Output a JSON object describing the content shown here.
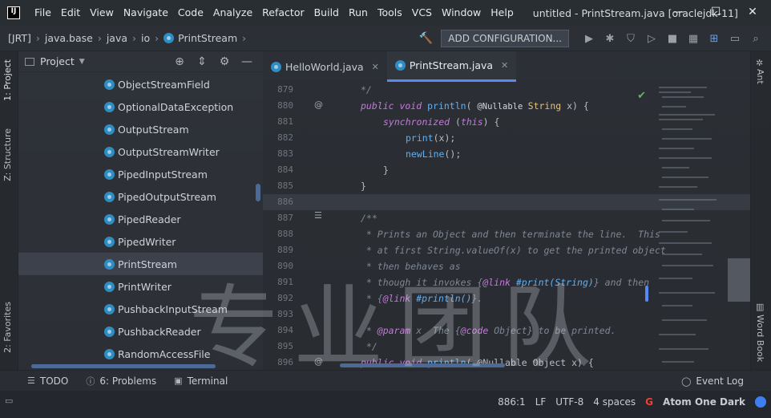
{
  "titlebar": {
    "app_logo": "IJ",
    "menu": [
      "File",
      "Edit",
      "View",
      "Navigate",
      "Code",
      "Analyze",
      "Refactor",
      "Build",
      "Run",
      "Tools",
      "VCS",
      "Window",
      "Help"
    ],
    "window_title": "untitled - PrintStream.java [oraclejdk-11]",
    "controls": {
      "minimize": "—",
      "maximize": "☐",
      "close": "✕"
    }
  },
  "navbar": {
    "breadcrumbs": [
      "[JRT]",
      "java.base",
      "java",
      "io",
      "PrintStream"
    ],
    "add_configuration": "ADD CONFIGURATION..."
  },
  "left_stripe": {
    "project_tab": "1: Project",
    "structure_tab": "Z: Structure",
    "favorites_tab": "2: Favorites"
  },
  "right_stripe": {
    "ant_tab": "Ant",
    "word_book_tab": "Word Book"
  },
  "project_panel": {
    "title": "Project",
    "items": [
      {
        "label": "ObjectStreamField"
      },
      {
        "label": "OptionalDataException"
      },
      {
        "label": "OutputStream"
      },
      {
        "label": "OutputStreamWriter"
      },
      {
        "label": "PipedInputStream"
      },
      {
        "label": "PipedOutputStream"
      },
      {
        "label": "PipedReader"
      },
      {
        "label": "PipedWriter"
      },
      {
        "label": "PrintStream",
        "selected": true
      },
      {
        "label": "PrintWriter"
      },
      {
        "label": "PushbackInputStream"
      },
      {
        "label": "PushbackReader"
      },
      {
        "label": "RandomAccessFile"
      }
    ]
  },
  "editor": {
    "tabs": [
      {
        "label": "HelloWorld.java",
        "active": false
      },
      {
        "label": "PrintStream.java",
        "active": true
      }
    ],
    "lines": [
      "879",
      "880",
      "881",
      "882",
      "883",
      "884",
      "885",
      "886",
      "887",
      "888",
      "889",
      "890",
      "891",
      "892",
      "893",
      "894",
      "895",
      "896"
    ],
    "code": {
      "l879": "*/",
      "l880_a": "public void ",
      "l880_b": "println",
      "l880_c": "( ",
      "l880_d": "@Nullable ",
      "l880_e": "String ",
      "l880_f": "x) {",
      "l881_a": "synchronized ",
      "l881_b": "(",
      "l881_c": "this",
      "l881_d": ") {",
      "l882_a": "print",
      "l882_b": "(x);",
      "l883_a": "newLine",
      "l883_b": "();",
      "l884": "}",
      "l885": "}",
      "l887": "/**",
      "l888": " * Prints an Object and then terminate the line.  This",
      "l889": " * at first String.valueOf(x) to get the printed object",
      "l890": " * then behaves as",
      "l891_a": " * though it invokes {",
      "l891_b": "@link ",
      "l891_c": "#print(String)",
      "l891_d": "} and then",
      "l892_a": " * {",
      "l892_b": "@link ",
      "l892_c": "#println()",
      "l892_d": "}.",
      "l894_a": " * ",
      "l894_b": "@param ",
      "l894_c": "x  The {",
      "l894_d": "@code ",
      "l894_e": "Object} to be printed.",
      "l895": " */",
      "l896_a": "public void ",
      "l896_b": "println",
      "l896_c": "( @Nullable Object x) {"
    }
  },
  "bottombar": {
    "todo": "TODO",
    "problems": "6: Problems",
    "terminal": "Terminal",
    "event_log": "Event Log"
  },
  "statusbar": {
    "position": "886:1",
    "line_sep": "LF",
    "encoding": "UTF-8",
    "indent": "4 spaces",
    "theme": "Atom One Dark"
  },
  "watermark": "专业团队",
  "colors": {
    "accent": "#568af2",
    "class_icon": "#2e8ec4",
    "keyword": "#c678dd",
    "function": "#61afef",
    "type": "#e5c07b"
  }
}
